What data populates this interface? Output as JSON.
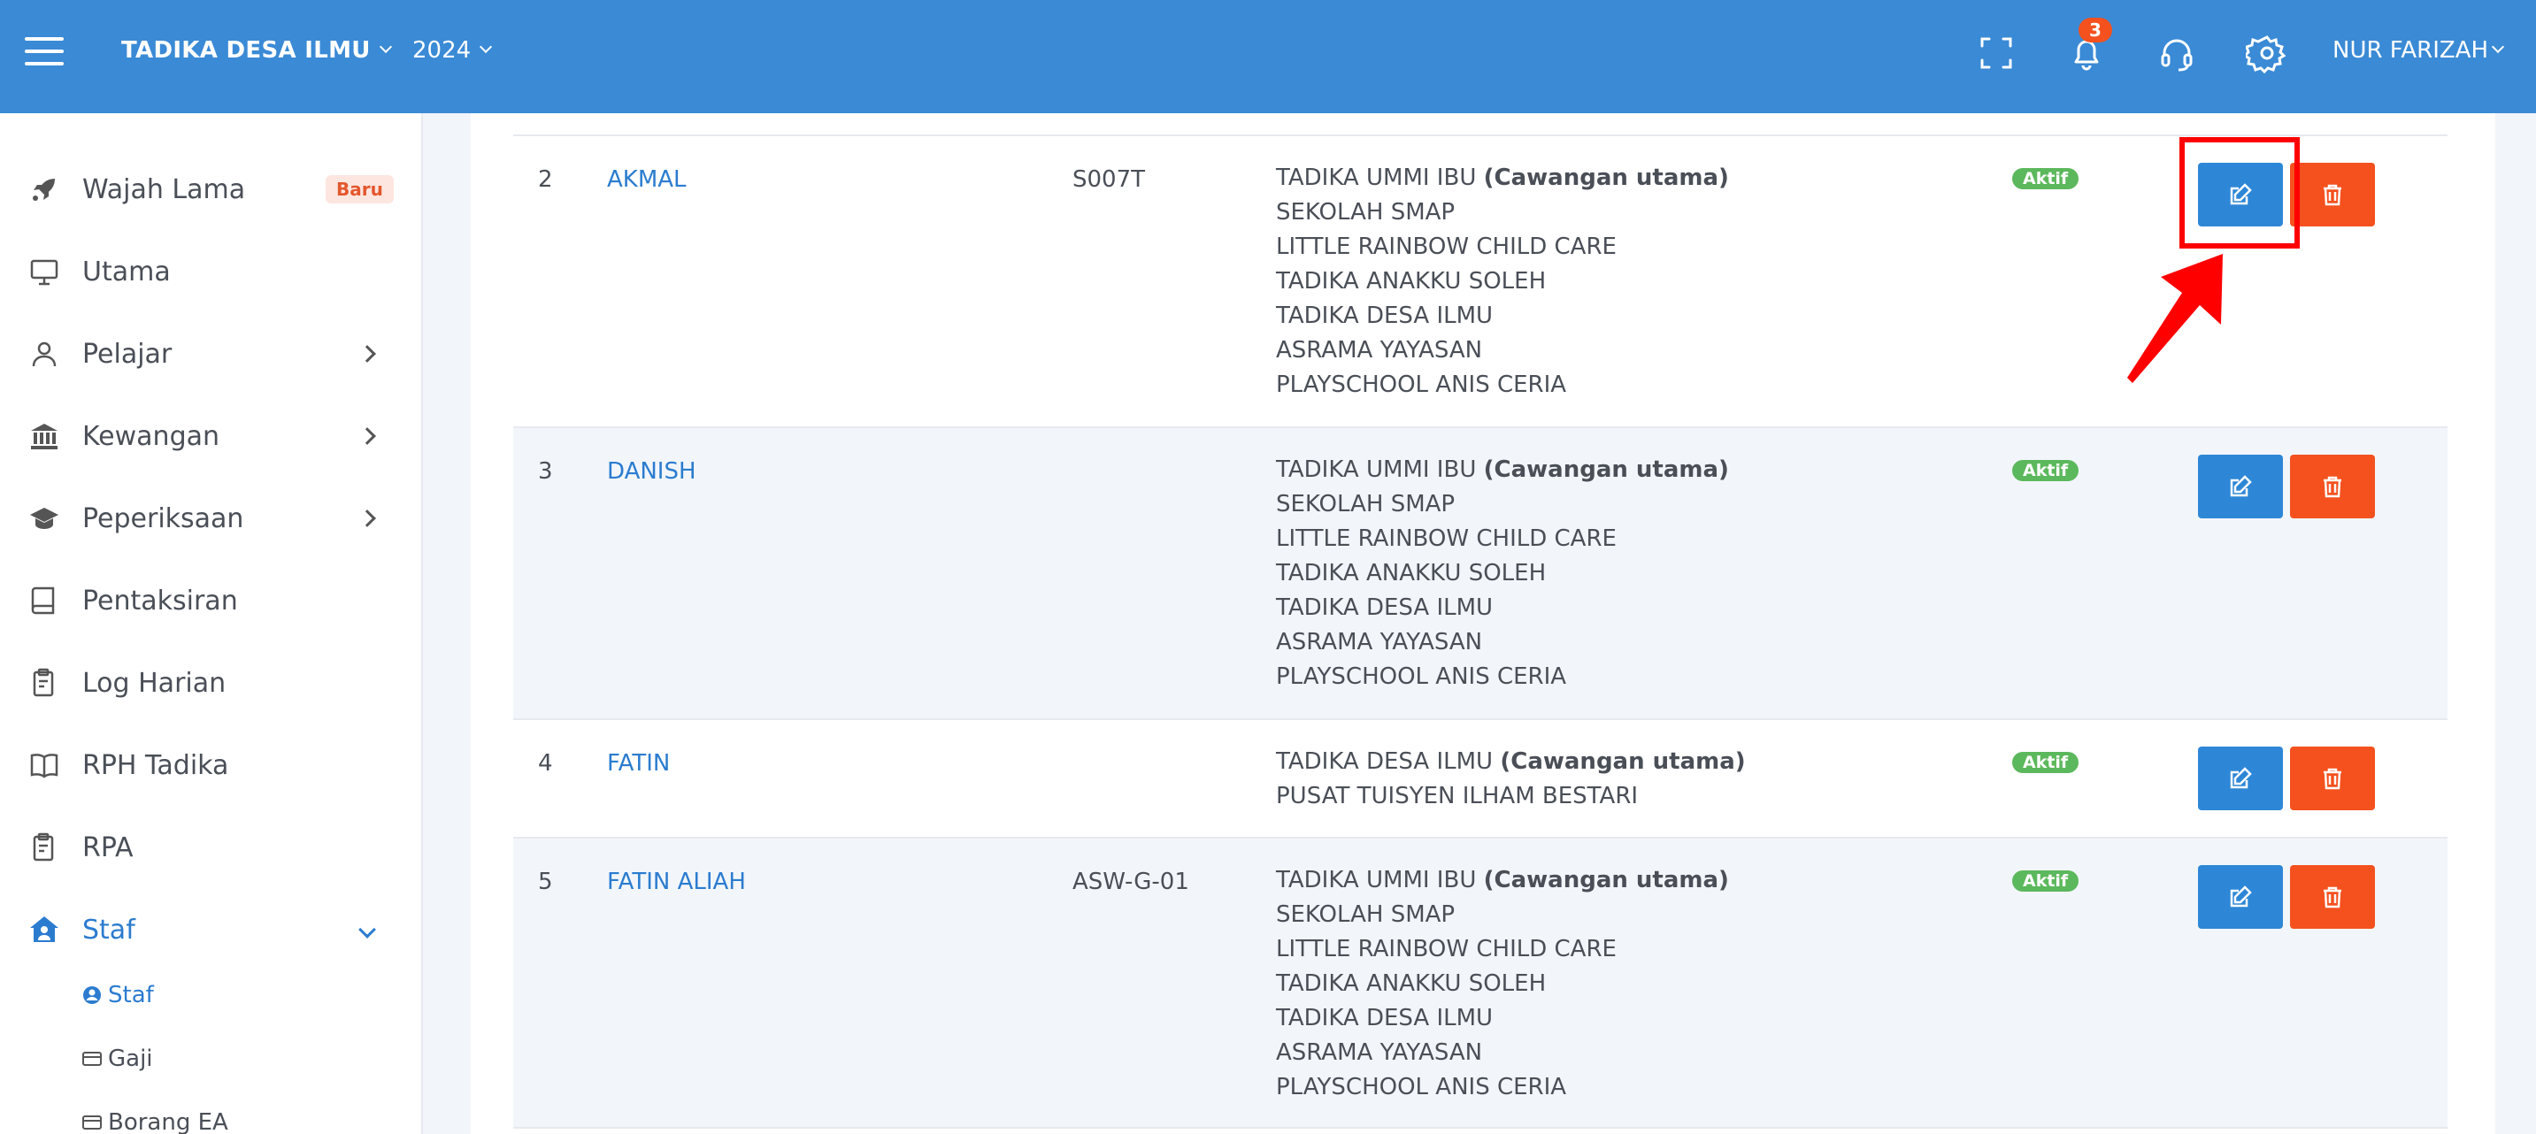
{
  "topbar": {
    "school": "TADIKA DESA ILMU",
    "year": "2024",
    "notification_count": "3",
    "user": "NUR FARIZAH"
  },
  "sidebar": {
    "items": [
      {
        "label": "Wajah Lama",
        "badge": "Baru",
        "icon": "rocket-icon"
      },
      {
        "label": "Utama",
        "icon": "monitor-icon"
      },
      {
        "label": "Pelajar",
        "icon": "user-icon"
      },
      {
        "label": "Kewangan",
        "icon": "bank-icon"
      },
      {
        "label": "Peperiksaan",
        "icon": "graduation-cap-icon"
      },
      {
        "label": "Pentaksiran",
        "icon": "book-icon"
      },
      {
        "label": "Log Harian",
        "icon": "clipboard-icon"
      },
      {
        "label": "RPH Tadika",
        "icon": "open-book-icon"
      },
      {
        "label": "RPA",
        "icon": "clipboard-icon"
      },
      {
        "label": "Staf",
        "icon": "house-user-icon"
      }
    ],
    "subitems": [
      {
        "label": "Staf",
        "icon": "user-circle-icon"
      },
      {
        "label": "Gaji",
        "icon": "card-icon"
      },
      {
        "label": "Borang EA",
        "icon": "card-icon"
      }
    ]
  },
  "table": {
    "status_label": "Aktif",
    "rows": [
      {
        "num": "2",
        "name": "AKMAL",
        "code": "S007T",
        "main_branch": "TADIKA UMMI IBU",
        "main_tag": "(Cawangan utama)",
        "others": [
          "SEKOLAH SMAP",
          "LITTLE RAINBOW CHILD CARE",
          "TADIKA ANAKKU SOLEH",
          "TADIKA DESA ILMU",
          "ASRAMA YAYASAN",
          "PLAYSCHOOL ANIS CERIA"
        ]
      },
      {
        "num": "3",
        "name": "DANISH",
        "code": "",
        "main_branch": "TADIKA UMMI IBU",
        "main_tag": "(Cawangan utama)",
        "others": [
          "SEKOLAH SMAP",
          "LITTLE RAINBOW CHILD CARE",
          "TADIKA ANAKKU SOLEH",
          "TADIKA DESA ILMU",
          "ASRAMA YAYASAN",
          "PLAYSCHOOL ANIS CERIA"
        ]
      },
      {
        "num": "4",
        "name": "FATIN",
        "code": "",
        "main_branch": "TADIKA DESA ILMU",
        "main_tag": "(Cawangan utama)",
        "others": [
          "PUSAT TUISYEN ILHAM BESTARI"
        ]
      },
      {
        "num": "5",
        "name": "FATIN ALIAH",
        "code": "ASW-G-01",
        "main_branch": "TADIKA UMMI IBU",
        "main_tag": "(Cawangan utama)",
        "others": [
          "SEKOLAH SMAP",
          "LITTLE RAINBOW CHILD CARE",
          "TADIKA ANAKKU SOLEH",
          "TADIKA DESA ILMU",
          "ASRAMA YAYASAN",
          "PLAYSCHOOL ANIS CERIA"
        ]
      }
    ]
  },
  "colors": {
    "primary": "#3a8ad6",
    "edit": "#2e87d6",
    "delete": "#f4511e",
    "active_badge": "#5cb85c",
    "annotation": "#ff0000"
  }
}
